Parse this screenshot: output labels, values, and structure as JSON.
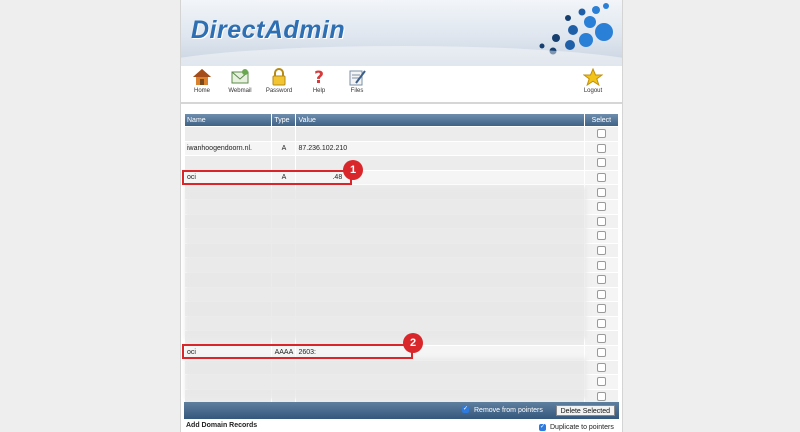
{
  "app": {
    "logo_text": "DirectAdmin"
  },
  "toolbar": {
    "items": [
      {
        "label": "Home",
        "icon": "home-icon"
      },
      {
        "label": "Webmail",
        "icon": "webmail-icon"
      },
      {
        "label": "Password",
        "icon": "lock-icon"
      },
      {
        "label": "Help",
        "icon": "help-icon"
      },
      {
        "label": "Files",
        "icon": "files-icon"
      }
    ],
    "logout_label": "Logout"
  },
  "table": {
    "headers": {
      "name": "Name",
      "type": "Type",
      "value": "Value",
      "select": "Select"
    },
    "rows": [
      {
        "name": "",
        "type": "",
        "value": ""
      },
      {
        "name": "iwanhoogendoorn.nl.",
        "type": "A",
        "value": "87.236.102.210"
      },
      {
        "name": "",
        "type": "",
        "value": ""
      },
      {
        "name": "oci",
        "type": "A",
        "value": ".48"
      },
      {
        "name": "",
        "type": "",
        "value": ""
      },
      {
        "name": "",
        "type": "",
        "value": ""
      },
      {
        "name": "",
        "type": "",
        "value": ""
      },
      {
        "name": "",
        "type": "",
        "value": ""
      },
      {
        "name": "",
        "type": "",
        "value": ""
      },
      {
        "name": "",
        "type": "",
        "value": ""
      },
      {
        "name": "",
        "type": "",
        "value": ""
      },
      {
        "name": "",
        "type": "",
        "value": ""
      },
      {
        "name": "",
        "type": "",
        "value": ""
      },
      {
        "name": "",
        "type": "",
        "value": ""
      },
      {
        "name": "",
        "type": "",
        "value": ""
      },
      {
        "name": "oci",
        "type": "AAAA",
        "value": "2603:"
      },
      {
        "name": "",
        "type": "",
        "value": ""
      },
      {
        "name": "",
        "type": "",
        "value": ""
      },
      {
        "name": "",
        "type": "",
        "value": ""
      }
    ]
  },
  "annotations": [
    {
      "label": "1"
    },
    {
      "label": "2"
    }
  ],
  "footer": {
    "remove_pointers_label": "Remove from pointers",
    "delete_label": "Delete Selected"
  },
  "add_section": {
    "title": "Add Domain Records",
    "duplicate_label": "Duplicate to pointers"
  },
  "colors": {
    "annotation": "#d9262a",
    "header_bar": "#3f6286",
    "brand": "#2d6fb2"
  }
}
